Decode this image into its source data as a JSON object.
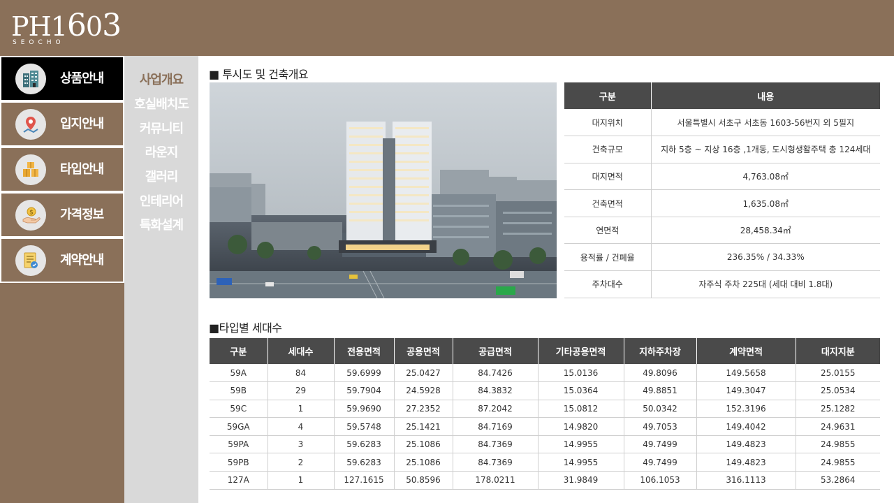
{
  "logo": {
    "main_a": "PH1",
    "main_b": "6",
    "main_c": "0",
    "main_d": "3",
    "sub": "SEOCHO"
  },
  "left_nav": [
    {
      "label": "상품안내",
      "icon": "building-icon",
      "active": true
    },
    {
      "label": "입지안내",
      "icon": "map-pin-icon",
      "active": false
    },
    {
      "label": "타입안내",
      "icon": "boxes-icon",
      "active": false
    },
    {
      "label": "가격정보",
      "icon": "price-hand-icon",
      "active": false
    },
    {
      "label": "계약안내",
      "icon": "contract-icon",
      "active": false
    }
  ],
  "sub_nav": [
    {
      "label": "사업개요",
      "active": true
    },
    {
      "label": "호실배치도",
      "active": false
    },
    {
      "label": "커뮤니티",
      "active": false
    },
    {
      "label": "라운지",
      "active": false
    },
    {
      "label": "갤러리",
      "active": false
    },
    {
      "label": "인테리어",
      "active": false
    },
    {
      "label": "특화설계",
      "active": false
    }
  ],
  "section1": {
    "title": "■ 투시도 및 건축개요"
  },
  "overview": {
    "headers": [
      "구분",
      "내용"
    ],
    "rows": [
      [
        "대지위치",
        "서울특별시 서초구 서초동 1603-56번지 외 5필지"
      ],
      [
        "건축규모",
        "지하 5층 ~ 지상 16층 ,1개동, 도시형생활주택 총 124세대"
      ],
      [
        "대지면적",
        "4,763.08㎡"
      ],
      [
        "건축면적",
        "1,635.08㎡"
      ],
      [
        "연면적",
        "28,458.34㎡"
      ],
      [
        "용적률 / 건폐율",
        "236.35% / 34.33%"
      ],
      [
        "주차대수",
        "자주식 주차 225대 (세대 대비 1.8대)"
      ]
    ]
  },
  "section2": {
    "title": "■타입별 세대수"
  },
  "types": {
    "headers": [
      "구분",
      "세대수",
      "전용면적",
      "공용면적",
      "공급면적",
      "기타공용면적",
      "지하주차장",
      "계약면적",
      "대지지분"
    ],
    "rows": [
      [
        "59A",
        "84",
        "59.6999",
        "25.0427",
        "84.7426",
        "15.0136",
        "49.8096",
        "149.5658",
        "25.0155"
      ],
      [
        "59B",
        "29",
        "59.7904",
        "24.5928",
        "84.3832",
        "15.0364",
        "49.8851",
        "149.3047",
        "25.0534"
      ],
      [
        "59C",
        "1",
        "59.9690",
        "27.2352",
        "87.2042",
        "15.0812",
        "50.0342",
        "152.3196",
        "25.1282"
      ],
      [
        "59GA",
        "4",
        "59.5748",
        "25.1421",
        "84.7169",
        "14.9820",
        "49.7053",
        "149.4042",
        "24.9631"
      ],
      [
        "59PA",
        "3",
        "59.6283",
        "25.1086",
        "84.7369",
        "14.9955",
        "49.7499",
        "149.4823",
        "24.9855"
      ],
      [
        "59PB",
        "2",
        "59.6283",
        "25.1086",
        "84.7369",
        "14.9955",
        "49.7499",
        "149.4823",
        "24.9855"
      ],
      [
        "127A",
        "1",
        "127.1615",
        "50.8596",
        "178.0211",
        "31.9849",
        "106.1053",
        "316.1113",
        "53.2864"
      ]
    ]
  },
  "colors": {
    "brand": "#8a7059",
    "active_nav": "#000000",
    "subnav_bg": "#d9d9d9",
    "table_header": "#4a4a4a"
  }
}
